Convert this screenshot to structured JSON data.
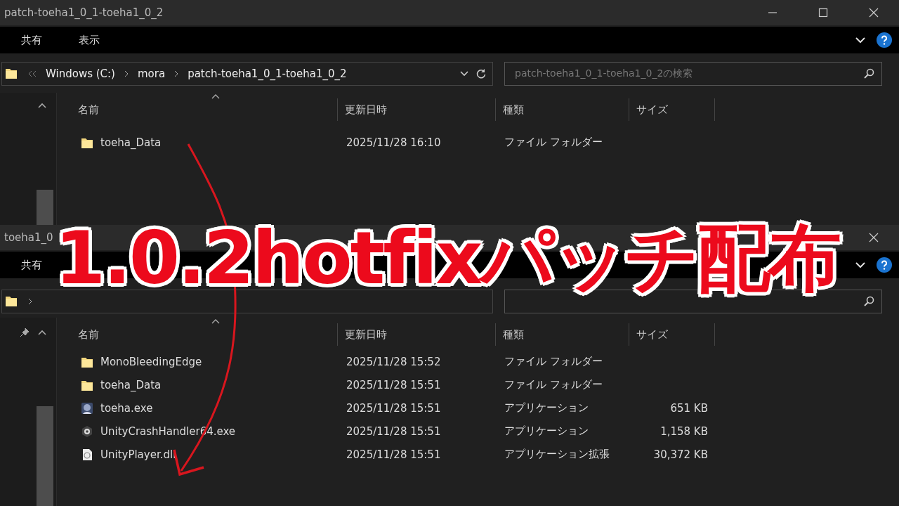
{
  "windows": [
    {
      "title": "patch-toeha1_0_1-toeha1_0_2",
      "buttons": [
        {
          "kind": "minimize"
        },
        {
          "kind": "maximize"
        },
        {
          "kind": "close"
        }
      ],
      "ribbon_tabs": [
        "共有",
        "表示"
      ],
      "breadcrumb": [
        "Windows (C:)",
        "mora",
        "patch-toeha1_0_1-toeha1_0_2"
      ],
      "search": {
        "placeholder": "patch-toeha1_0_1-toeha1_0_2の検索"
      },
      "pinned": false,
      "columns": [
        "名前",
        "更新日時",
        "種類",
        "サイズ"
      ],
      "rows": [
        {
          "kind": "folder",
          "name": "toeha_Data",
          "date": "2025/11/28 16:10",
          "type": "ファイル フォルダー"
        }
      ]
    },
    {
      "title": "toeha1_0",
      "buttons": [
        {
          "kind": "close"
        }
      ],
      "ribbon_tabs": [
        "共有"
      ],
      "pinned": true,
      "columns": [
        "名前",
        "更新日時",
        "種類",
        "サイズ"
      ],
      "rows": [
        {
          "kind": "folder",
          "name": "MonoBleedingEdge",
          "date": "2025/11/28 15:52",
          "type": "ファイル フォルダー"
        },
        {
          "kind": "folder",
          "name": "toeha_Data",
          "date": "2025/11/28 15:51",
          "type": "ファイル フォルダー"
        },
        {
          "kind": "app",
          "name": "toeha.exe",
          "date": "2025/11/28 15:51",
          "type": "アプリケーション",
          "size": "651 KB"
        },
        {
          "kind": "crash",
          "name": "UnityCrashHandler64.exe",
          "date": "2025/11/28 15:51",
          "type": "アプリケーション",
          "size": "1,158 KB"
        },
        {
          "kind": "dll",
          "name": "UnityPlayer.dll",
          "date": "2025/11/28 15:51",
          "type": "アプリケーション拡張",
          "size": "30,372 KB"
        }
      ]
    }
  ],
  "banner": "1.0.2hotfixパッチ配布"
}
